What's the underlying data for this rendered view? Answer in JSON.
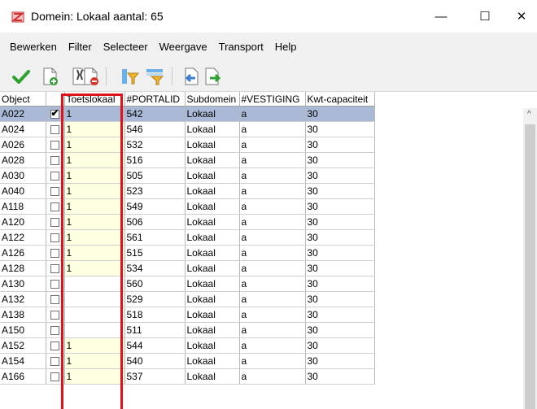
{
  "window": {
    "title": "Domein: Lokaal aantal: 65",
    "minimize_glyph": "—",
    "maximize_glyph": "☐",
    "close_glyph": "✕"
  },
  "menu": {
    "items": [
      "Bewerken",
      "Filter",
      "Selecteer",
      "Weergave",
      "Transport",
      "Help"
    ]
  },
  "toolbar": {
    "icons": [
      "checkmark-icon",
      "add-document-icon",
      "edit-tools-icon",
      "delete-document-icon",
      "filter-icon",
      "filter-options-icon",
      "import-icon",
      "export-icon"
    ]
  },
  "grid": {
    "columns": [
      "Object",
      "",
      "Toetslokaal",
      "#PORTALID",
      "Subdomein",
      "#VESTIGING",
      "Kwt-capaciteit"
    ],
    "rows": [
      {
        "object": "A022",
        "checked": true,
        "toets": "1",
        "portal": "542",
        "sub": "Lokaal",
        "vest": "a",
        "kwt": "30"
      },
      {
        "object": "A024",
        "checked": false,
        "toets": "1",
        "portal": "546",
        "sub": "Lokaal",
        "vest": "a",
        "kwt": "30"
      },
      {
        "object": "A026",
        "checked": false,
        "toets": "1",
        "portal": "532",
        "sub": "Lokaal",
        "vest": "a",
        "kwt": "30"
      },
      {
        "object": "A028",
        "checked": false,
        "toets": "1",
        "portal": "516",
        "sub": "Lokaal",
        "vest": "a",
        "kwt": "30"
      },
      {
        "object": "A030",
        "checked": false,
        "toets": "1",
        "portal": "505",
        "sub": "Lokaal",
        "vest": "a",
        "kwt": "30"
      },
      {
        "object": "A040",
        "checked": false,
        "toets": "1",
        "portal": "523",
        "sub": "Lokaal",
        "vest": "a",
        "kwt": "30"
      },
      {
        "object": "A118",
        "checked": false,
        "toets": "1",
        "portal": "549",
        "sub": "Lokaal",
        "vest": "a",
        "kwt": "30"
      },
      {
        "object": "A120",
        "checked": false,
        "toets": "1",
        "portal": "506",
        "sub": "Lokaal",
        "vest": "a",
        "kwt": "30"
      },
      {
        "object": "A122",
        "checked": false,
        "toets": "1",
        "portal": "561",
        "sub": "Lokaal",
        "vest": "a",
        "kwt": "30"
      },
      {
        "object": "A126",
        "checked": false,
        "toets": "1",
        "portal": "515",
        "sub": "Lokaal",
        "vest": "a",
        "kwt": "30"
      },
      {
        "object": "A128",
        "checked": false,
        "toets": "1",
        "portal": "534",
        "sub": "Lokaal",
        "vest": "a",
        "kwt": "30"
      },
      {
        "object": "A130",
        "checked": false,
        "toets": "",
        "portal": "560",
        "sub": "Lokaal",
        "vest": "a",
        "kwt": "30"
      },
      {
        "object": "A132",
        "checked": false,
        "toets": "",
        "portal": "529",
        "sub": "Lokaal",
        "vest": "a",
        "kwt": "30"
      },
      {
        "object": "A138",
        "checked": false,
        "toets": "",
        "portal": "518",
        "sub": "Lokaal",
        "vest": "a",
        "kwt": "30"
      },
      {
        "object": "A150",
        "checked": false,
        "toets": "",
        "portal": "511",
        "sub": "Lokaal",
        "vest": "a",
        "kwt": "30"
      },
      {
        "object": "A152",
        "checked": false,
        "toets": "1",
        "portal": "544",
        "sub": "Lokaal",
        "vest": "a",
        "kwt": "30"
      },
      {
        "object": "A154",
        "checked": false,
        "toets": "1",
        "portal": "540",
        "sub": "Lokaal",
        "vest": "a",
        "kwt": "30"
      },
      {
        "object": "A166",
        "checked": false,
        "toets": "1",
        "portal": "537",
        "sub": "Lokaal",
        "vest": "a",
        "kwt": "30"
      }
    ]
  },
  "colors": {
    "selected_row": "#aab9d6",
    "toets_column": "#ffffe1",
    "highlight_border": "#e0111b"
  }
}
